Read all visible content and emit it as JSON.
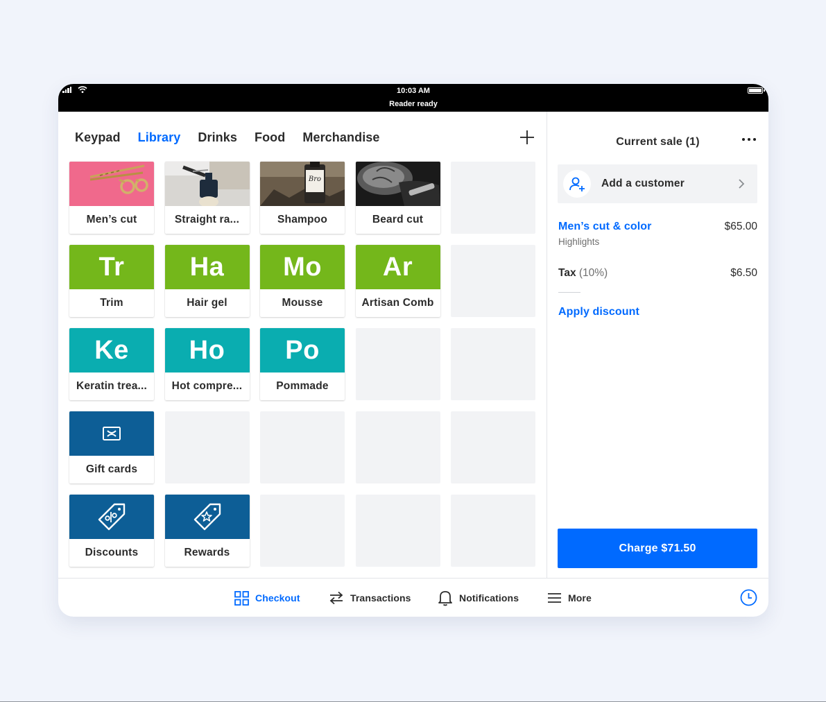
{
  "status_bar": {
    "time": "10:03 AM",
    "reader_status": "Reader ready"
  },
  "tabs": [
    {
      "label": "Keypad",
      "active": false
    },
    {
      "label": "Library",
      "active": true
    },
    {
      "label": "Drinks",
      "active": false
    },
    {
      "label": "Food",
      "active": false
    },
    {
      "label": "Merchandise",
      "active": false
    }
  ],
  "library": {
    "photo_items": [
      {
        "label": "Men’s cut",
        "icon": "scissors-photo"
      },
      {
        "label": "Straight ra...",
        "icon": "razor-photo"
      },
      {
        "label": "Shampoo",
        "icon": "shampoo-bottle-photo",
        "bottle_text": "Bro"
      },
      {
        "label": "Beard cut",
        "icon": "beard-trim-photo"
      }
    ],
    "green_items": [
      {
        "abbr": "Tr",
        "label": "Trim"
      },
      {
        "abbr": "Ha",
        "label": "Hair gel"
      },
      {
        "abbr": "Mo",
        "label": "Mousse"
      },
      {
        "abbr": "Ar",
        "label": "Artisan Comb"
      }
    ],
    "teal_items": [
      {
        "abbr": "Ke",
        "label": "Keratin trea..."
      },
      {
        "abbr": "Ho",
        "label": "Hot compre..."
      },
      {
        "abbr": "Po",
        "label": "Pommade"
      }
    ],
    "special_items": {
      "gift_cards": {
        "label": "Gift cards",
        "icon": "gift-card-icon"
      },
      "discounts": {
        "label": "Discounts",
        "icon": "discount-tag-icon"
      },
      "rewards": {
        "label": "Rewards",
        "icon": "reward-tag-icon"
      }
    }
  },
  "sale": {
    "title": "Current sale (1)",
    "add_customer_label": "Add a customer",
    "line_items": [
      {
        "name": "Men’s cut & color",
        "modifier": "Highlights",
        "price": "$65.00"
      }
    ],
    "tax": {
      "label": "Tax",
      "rate": "(10%)",
      "amount": "$6.50"
    },
    "apply_discount_label": "Apply discount",
    "charge_label": "Charge $71.50"
  },
  "bottom_nav": [
    {
      "label": "Checkout",
      "icon": "grid-icon",
      "active": true
    },
    {
      "label": "Transactions",
      "icon": "swap-arrows-icon",
      "active": false
    },
    {
      "label": "Notifications",
      "icon": "bell-icon",
      "active": false
    },
    {
      "label": "More",
      "icon": "hamburger-menu-icon",
      "active": false
    }
  ],
  "colors": {
    "accent": "#006aff",
    "green_tile": "#74b71b",
    "teal_tile": "#0aadb0",
    "navy_tile": "#0d5e96",
    "background": "#f1f4fb"
  }
}
